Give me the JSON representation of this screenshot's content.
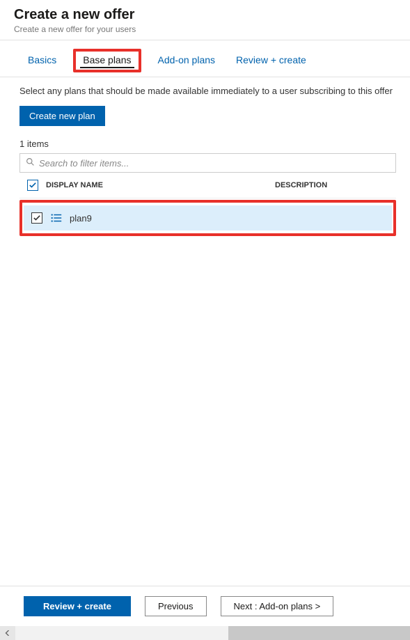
{
  "header": {
    "title": "Create a new offer",
    "subtitle": "Create a new offer for your users"
  },
  "tabs": {
    "items": [
      {
        "label": "Basics"
      },
      {
        "label": "Base plans"
      },
      {
        "label": "Add-on plans"
      },
      {
        "label": "Review + create"
      }
    ],
    "activeIndex": 1
  },
  "content": {
    "description": "Select any plans that should be made available immediately to a user subscribing to this offer",
    "createButton": "Create new plan",
    "itemCount": "1 items",
    "search": {
      "placeholder": "Search to filter items..."
    },
    "columns": {
      "name": "DISPLAY NAME",
      "desc": "DESCRIPTION"
    },
    "rows": [
      {
        "name": "plan9",
        "checked": true,
        "description": ""
      }
    ]
  },
  "footer": {
    "review": "Review + create",
    "previous": "Previous",
    "next": "Next : Add-on plans >"
  }
}
